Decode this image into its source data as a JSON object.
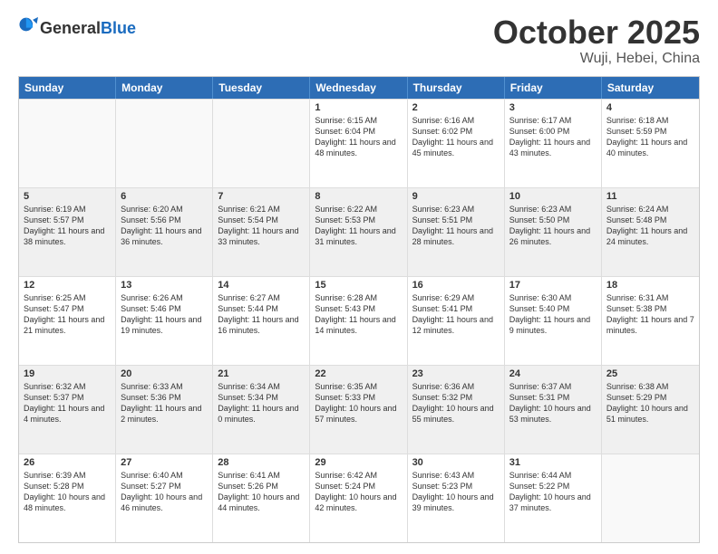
{
  "header": {
    "logo_general": "General",
    "logo_blue": "Blue",
    "month": "October 2025",
    "location": "Wuji, Hebei, China"
  },
  "days_of_week": [
    "Sunday",
    "Monday",
    "Tuesday",
    "Wednesday",
    "Thursday",
    "Friday",
    "Saturday"
  ],
  "rows": [
    [
      {
        "day": "",
        "info": "",
        "empty": true
      },
      {
        "day": "",
        "info": "",
        "empty": true
      },
      {
        "day": "",
        "info": "",
        "empty": true
      },
      {
        "day": "1",
        "info": "Sunrise: 6:15 AM\nSunset: 6:04 PM\nDaylight: 11 hours\nand 48 minutes."
      },
      {
        "day": "2",
        "info": "Sunrise: 6:16 AM\nSunset: 6:02 PM\nDaylight: 11 hours\nand 45 minutes."
      },
      {
        "day": "3",
        "info": "Sunrise: 6:17 AM\nSunset: 6:00 PM\nDaylight: 11 hours\nand 43 minutes."
      },
      {
        "day": "4",
        "info": "Sunrise: 6:18 AM\nSunset: 5:59 PM\nDaylight: 11 hours\nand 40 minutes."
      }
    ],
    [
      {
        "day": "5",
        "info": "Sunrise: 6:19 AM\nSunset: 5:57 PM\nDaylight: 11 hours\nand 38 minutes.",
        "shaded": true
      },
      {
        "day": "6",
        "info": "Sunrise: 6:20 AM\nSunset: 5:56 PM\nDaylight: 11 hours\nand 36 minutes.",
        "shaded": true
      },
      {
        "day": "7",
        "info": "Sunrise: 6:21 AM\nSunset: 5:54 PM\nDaylight: 11 hours\nand 33 minutes.",
        "shaded": true
      },
      {
        "day": "8",
        "info": "Sunrise: 6:22 AM\nSunset: 5:53 PM\nDaylight: 11 hours\nand 31 minutes.",
        "shaded": true
      },
      {
        "day": "9",
        "info": "Sunrise: 6:23 AM\nSunset: 5:51 PM\nDaylight: 11 hours\nand 28 minutes.",
        "shaded": true
      },
      {
        "day": "10",
        "info": "Sunrise: 6:23 AM\nSunset: 5:50 PM\nDaylight: 11 hours\nand 26 minutes.",
        "shaded": true
      },
      {
        "day": "11",
        "info": "Sunrise: 6:24 AM\nSunset: 5:48 PM\nDaylight: 11 hours\nand 24 minutes.",
        "shaded": true
      }
    ],
    [
      {
        "day": "12",
        "info": "Sunrise: 6:25 AM\nSunset: 5:47 PM\nDaylight: 11 hours\nand 21 minutes."
      },
      {
        "day": "13",
        "info": "Sunrise: 6:26 AM\nSunset: 5:46 PM\nDaylight: 11 hours\nand 19 minutes."
      },
      {
        "day": "14",
        "info": "Sunrise: 6:27 AM\nSunset: 5:44 PM\nDaylight: 11 hours\nand 16 minutes."
      },
      {
        "day": "15",
        "info": "Sunrise: 6:28 AM\nSunset: 5:43 PM\nDaylight: 11 hours\nand 14 minutes."
      },
      {
        "day": "16",
        "info": "Sunrise: 6:29 AM\nSunset: 5:41 PM\nDaylight: 11 hours\nand 12 minutes."
      },
      {
        "day": "17",
        "info": "Sunrise: 6:30 AM\nSunset: 5:40 PM\nDaylight: 11 hours\nand 9 minutes."
      },
      {
        "day": "18",
        "info": "Sunrise: 6:31 AM\nSunset: 5:38 PM\nDaylight: 11 hours\nand 7 minutes."
      }
    ],
    [
      {
        "day": "19",
        "info": "Sunrise: 6:32 AM\nSunset: 5:37 PM\nDaylight: 11 hours\nand 4 minutes.",
        "shaded": true
      },
      {
        "day": "20",
        "info": "Sunrise: 6:33 AM\nSunset: 5:36 PM\nDaylight: 11 hours\nand 2 minutes.",
        "shaded": true
      },
      {
        "day": "21",
        "info": "Sunrise: 6:34 AM\nSunset: 5:34 PM\nDaylight: 11 hours\nand 0 minutes.",
        "shaded": true
      },
      {
        "day": "22",
        "info": "Sunrise: 6:35 AM\nSunset: 5:33 PM\nDaylight: 10 hours\nand 57 minutes.",
        "shaded": true
      },
      {
        "day": "23",
        "info": "Sunrise: 6:36 AM\nSunset: 5:32 PM\nDaylight: 10 hours\nand 55 minutes.",
        "shaded": true
      },
      {
        "day": "24",
        "info": "Sunrise: 6:37 AM\nSunset: 5:31 PM\nDaylight: 10 hours\nand 53 minutes.",
        "shaded": true
      },
      {
        "day": "25",
        "info": "Sunrise: 6:38 AM\nSunset: 5:29 PM\nDaylight: 10 hours\nand 51 minutes.",
        "shaded": true
      }
    ],
    [
      {
        "day": "26",
        "info": "Sunrise: 6:39 AM\nSunset: 5:28 PM\nDaylight: 10 hours\nand 48 minutes."
      },
      {
        "day": "27",
        "info": "Sunrise: 6:40 AM\nSunset: 5:27 PM\nDaylight: 10 hours\nand 46 minutes."
      },
      {
        "day": "28",
        "info": "Sunrise: 6:41 AM\nSunset: 5:26 PM\nDaylight: 10 hours\nand 44 minutes."
      },
      {
        "day": "29",
        "info": "Sunrise: 6:42 AM\nSunset: 5:24 PM\nDaylight: 10 hours\nand 42 minutes."
      },
      {
        "day": "30",
        "info": "Sunrise: 6:43 AM\nSunset: 5:23 PM\nDaylight: 10 hours\nand 39 minutes."
      },
      {
        "day": "31",
        "info": "Sunrise: 6:44 AM\nSunset: 5:22 PM\nDaylight: 10 hours\nand 37 minutes."
      },
      {
        "day": "",
        "info": "",
        "empty": true
      }
    ]
  ]
}
